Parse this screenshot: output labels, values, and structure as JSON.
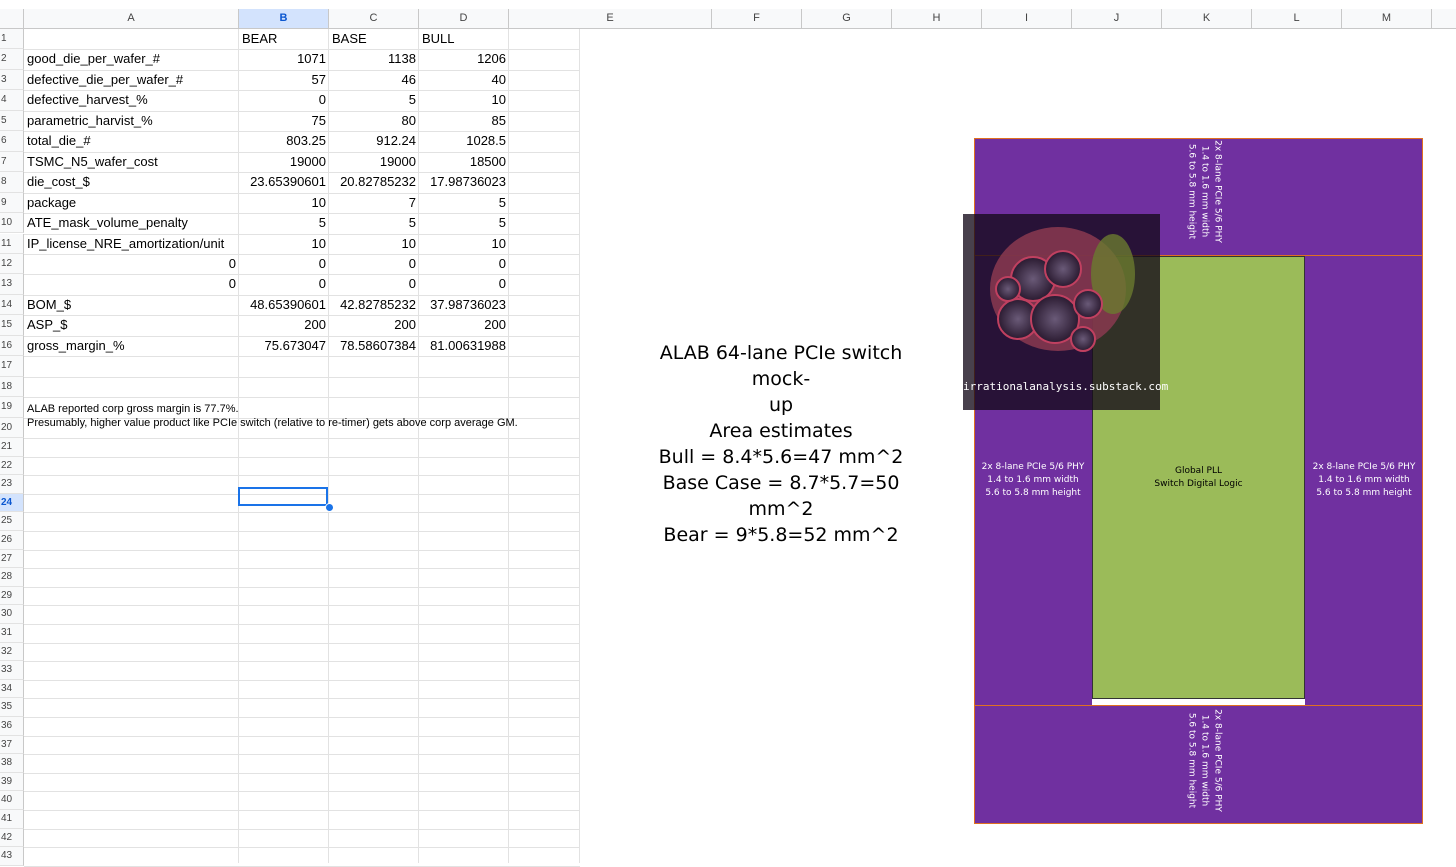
{
  "columns": [
    "A",
    "B",
    "C",
    "D",
    "E",
    "F",
    "G",
    "H",
    "I",
    "J",
    "K",
    "L",
    "M"
  ],
  "selected_column": "B",
  "rows": [
    "1",
    "2",
    "3",
    "4",
    "5",
    "6",
    "7",
    "8",
    "9",
    "10",
    "11",
    "12",
    "13",
    "14",
    "15",
    "16",
    "17",
    "18",
    "19",
    "20",
    "21",
    "22",
    "23",
    "24",
    "25",
    "26",
    "27",
    "28",
    "29",
    "30",
    "31",
    "32",
    "33",
    "34",
    "35",
    "36",
    "37",
    "38",
    "39",
    "40",
    "41",
    "42",
    "43"
  ],
  "selected_row": "24",
  "sheet": {
    "header": {
      "b": "BEAR",
      "c": "BASE",
      "d": "BULL"
    },
    "rows": [
      {
        "label": "good_die_per_wafer_#",
        "b": "1071",
        "c": "1138",
        "d": "1206"
      },
      {
        "label": "defective_die_per_wafer_#",
        "b": "57",
        "c": "46",
        "d": "40"
      },
      {
        "label": "defective_harvest_%",
        "b": "0",
        "c": "5",
        "d": "10"
      },
      {
        "label": "parametric_harvist_%",
        "b": "75",
        "c": "80",
        "d": "85"
      },
      {
        "label": "total_die_#",
        "b": "803.25",
        "c": "912.24",
        "d": "1028.5"
      },
      {
        "label": "TSMC_N5_wafer_cost",
        "b": "19000",
        "c": "19000",
        "d": "18500"
      },
      {
        "label": "die_cost_$",
        "b": "23.65390601",
        "c": "20.82785232",
        "d": "17.98736023"
      },
      {
        "label": "package",
        "b": "10",
        "c": "7",
        "d": "5"
      },
      {
        "label": "ATE_mask_volume_penalty",
        "b": "5",
        "c": "5",
        "d": "5"
      },
      {
        "label": "IP_license_NRE_amortization/unit",
        "b": "10",
        "c": "10",
        "d": "10"
      },
      {
        "a_num": "0",
        "b": "0",
        "c": "0",
        "d": "0"
      },
      {
        "a_num": "0",
        "b": "0",
        "c": "0",
        "d": "0"
      },
      {
        "label": "BOM_$",
        "b": "48.65390601",
        "c": "42.82785232",
        "d": "37.98736023"
      },
      {
        "label": "ASP_$",
        "b": "200",
        "c": "200",
        "d": "200"
      },
      {
        "label": "gross_margin_%",
        "b": "75.673047",
        "c": "78.58607384",
        "d": "81.00631988"
      }
    ],
    "note1": "ALAB reported corp gross margin is 77.7%.",
    "note2": "Presumably, higher value product like PCIe switch (relative to re-timer) gets above corp average GM."
  },
  "diagram": {
    "title_line1": "ALAB 64-lane PCIe switch mock-",
    "title_line2": "up",
    "area_heading": "Area estimates",
    "bull": "Bull = 8.4*5.6=47 mm^2",
    "base": "Base Case = 8.7*5.7=50 mm^2",
    "bear": "Bear = 9*5.8=52 mm^2",
    "phy_line1": "2x 8-lane PCIe 5/6 PHY",
    "phy_line2": "1.4 to 1.6 mm width",
    "phy_line3": "5.6 to 5.8 mm height",
    "logic_line1": "Global PLL",
    "logic_line2": "Switch Digital Logic",
    "watermark": "irrationalanalysis.substack.com",
    "colors": {
      "phy": "#7030a0",
      "logic": "#9bbb59",
      "outline": "#e07020"
    }
  }
}
